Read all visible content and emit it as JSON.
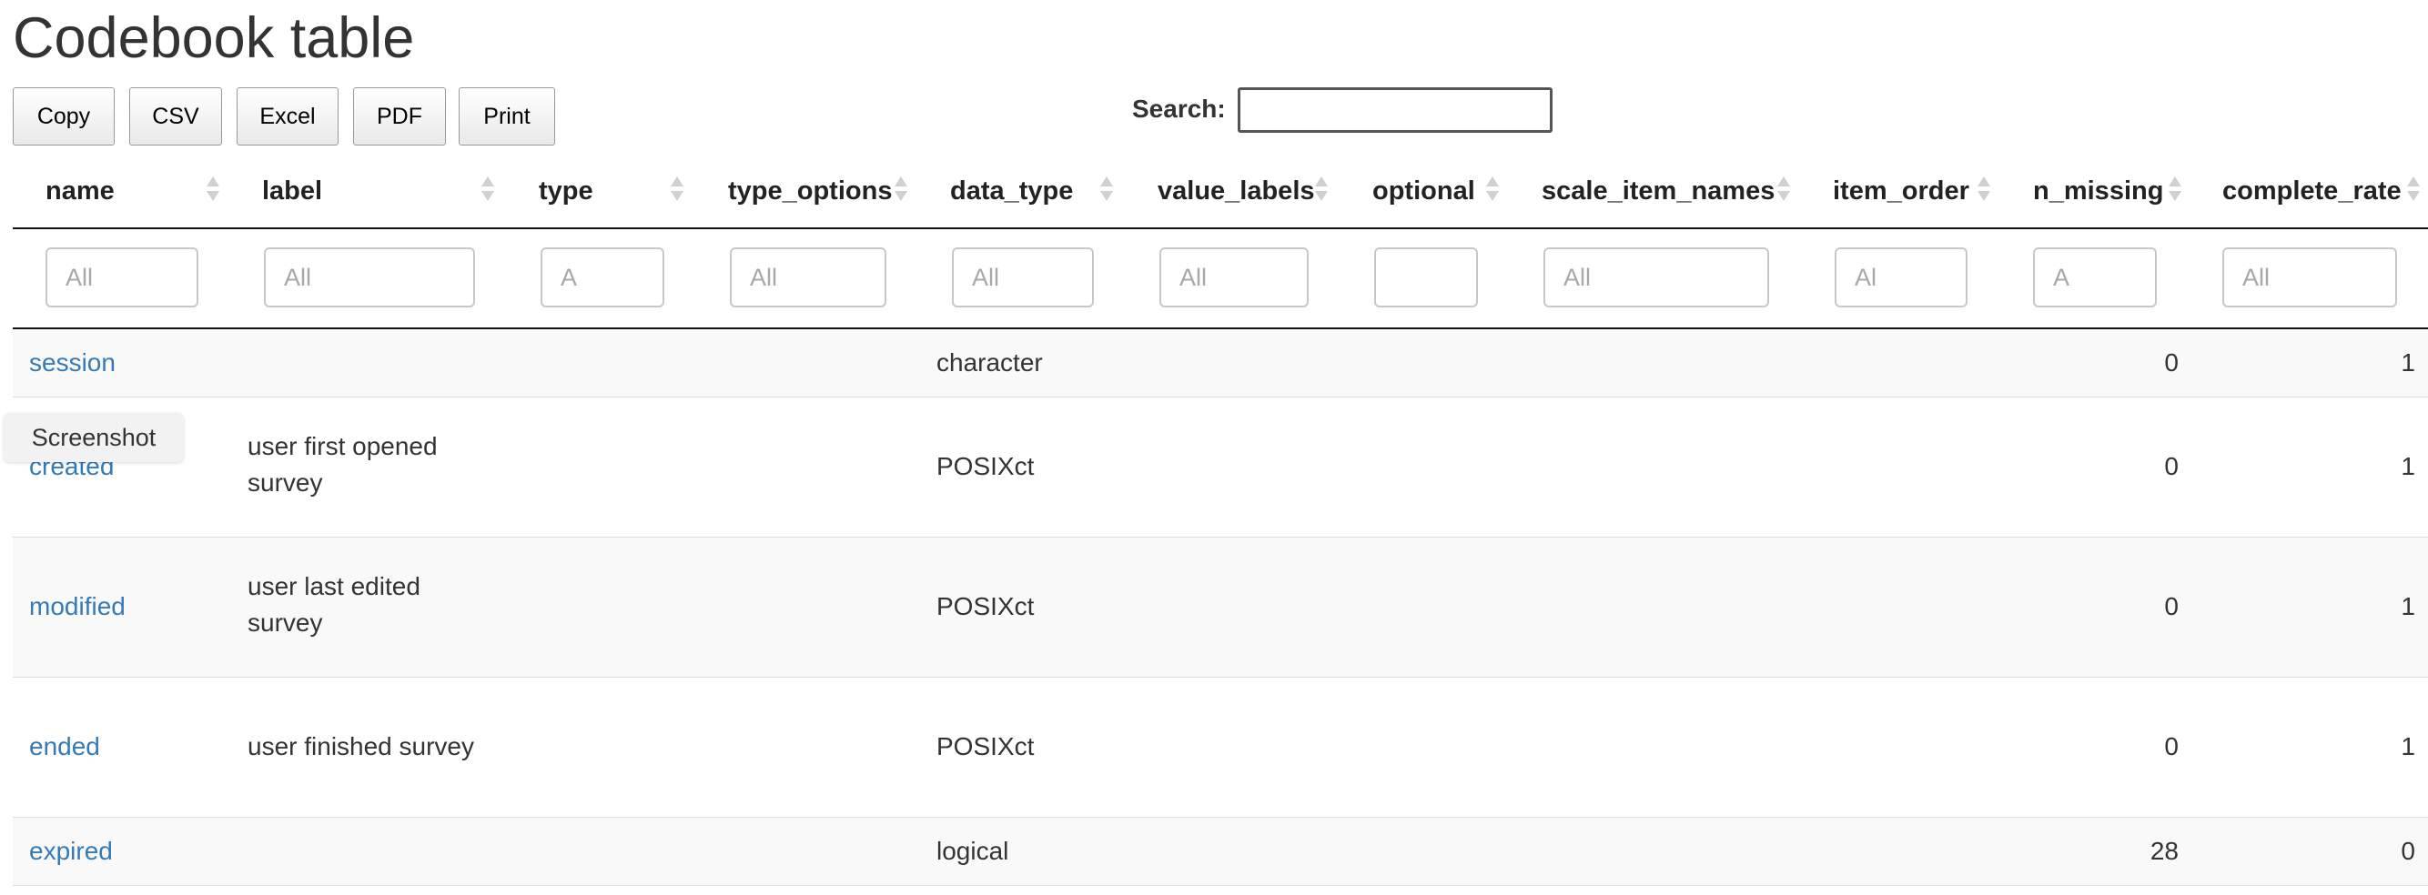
{
  "page": {
    "title": "Codebook table"
  },
  "toolbar": {
    "buttons": [
      "Copy",
      "CSV",
      "Excel",
      "PDF",
      "Print"
    ],
    "search_label": "Search:",
    "search_value": ""
  },
  "table": {
    "columns": [
      "name",
      "label",
      "type",
      "type_options",
      "data_type",
      "value_labels",
      "optional",
      "scale_item_names",
      "item_order",
      "n_missing",
      "complete_rate"
    ],
    "filters": [
      "All",
      "All",
      "A",
      "All",
      "All",
      "All",
      "",
      "All",
      "Al",
      "A",
      "All"
    ],
    "rows": [
      {
        "name": "session",
        "label": "",
        "data_type": "character",
        "n_missing": "0",
        "complete_rate": "1"
      },
      {
        "name": "created",
        "label_lines": [
          "user first opened",
          "survey"
        ],
        "data_type": "POSIXct",
        "n_missing": "0",
        "complete_rate": "1"
      },
      {
        "name": "modified",
        "label_lines": [
          "user last edited",
          "survey"
        ],
        "data_type": "POSIXct",
        "n_missing": "0",
        "complete_rate": "1"
      },
      {
        "name": "ended",
        "label_lines": [
          "user finished survey"
        ],
        "data_type": "POSIXct",
        "n_missing": "0",
        "complete_rate": "1"
      },
      {
        "name": "expired",
        "label": "",
        "data_type": "logical",
        "n_missing": "28",
        "complete_rate": "0"
      }
    ]
  },
  "tooltip": {
    "text": "Screenshot"
  }
}
